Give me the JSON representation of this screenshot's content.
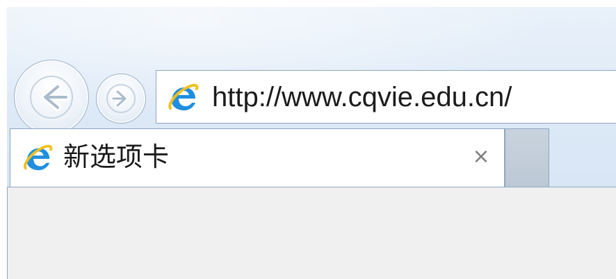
{
  "navigation": {
    "back_icon": "arrow-left-icon",
    "forward_icon": "arrow-right-icon"
  },
  "address_bar": {
    "icon": "internet-explorer-icon",
    "url": "http://www.cqvie.edu.cn/"
  },
  "tabs": [
    {
      "icon": "internet-explorer-icon",
      "title": "新选项卡",
      "close_label": "×"
    }
  ],
  "new_tab_button": {
    "icon": "new-tab-icon"
  },
  "colors": {
    "chrome_background": "#d3e3f4",
    "ie_blue": "#1e8fe0",
    "ie_gold": "#f0c020",
    "border": "#8ea6c0",
    "content_background": "#f0f0f0"
  }
}
